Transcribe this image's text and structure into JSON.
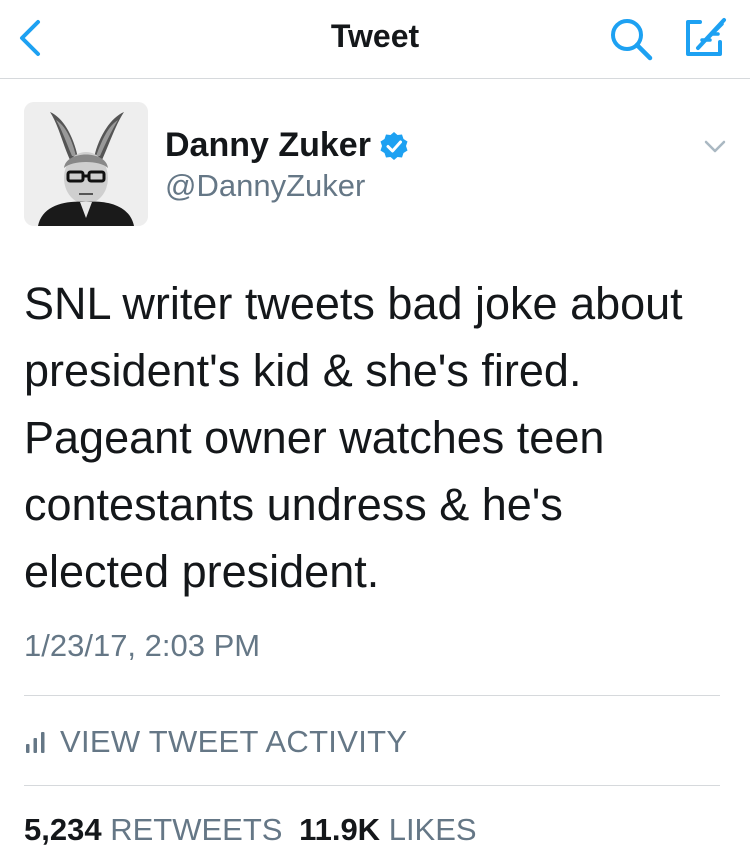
{
  "colors": {
    "accent": "#1da1f2",
    "text": "#14171a",
    "secondary": "#657786",
    "divider": "#d6d9dc"
  },
  "navbar": {
    "title": "Tweet",
    "back_icon": "chevron-left-icon",
    "search_icon": "search-icon",
    "compose_icon": "compose-icon"
  },
  "tweet": {
    "author": {
      "name": "Danny Zuker",
      "handle": "@DannyZuker",
      "verified": true
    },
    "lines": [
      "SNL writer tweets bad joke about",
      "president's kid & she's fired.",
      "Pageant owner watches teen",
      "contestants undress & he's",
      "elected president."
    ],
    "timestamp": "1/23/17, 2:03 PM",
    "activity_label": "VIEW TWEET ACTIVITY",
    "stats": {
      "retweets_count": "5,234",
      "retweets_label": "RETWEETS",
      "likes_count": "11.9K",
      "likes_label": "LIKES"
    }
  }
}
